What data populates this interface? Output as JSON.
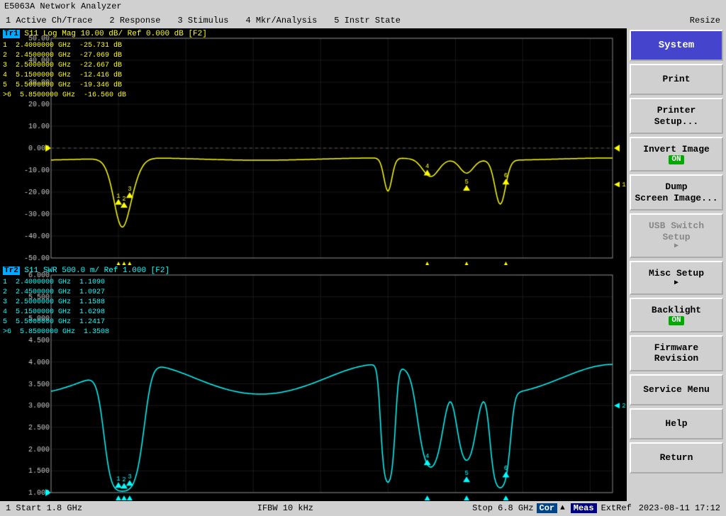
{
  "title": "E5063A Network Analyzer",
  "menu": {
    "items": [
      "1 Active Ch/Trace",
      "2 Response",
      "3 Stimulus",
      "4 Mkr/Analysis",
      "5 Instr State"
    ],
    "resize": "Resize"
  },
  "chart_top": {
    "trace_label": "Tr1",
    "trace_info": "S11  Log Mag  10.00 dB/  Ref  0.000 dB  [F2]",
    "y_max": "50.00",
    "y_ref": "0.000",
    "y_min": "-50.00",
    "markers": [
      {
        "id": "1",
        "freq": "2.4000000",
        "unit": "GHz",
        "val": "-25.731",
        "dbu": "dB"
      },
      {
        "id": "2",
        "freq": "2.4500000",
        "unit": "GHz",
        "val": "-27.069",
        "dbu": "dB"
      },
      {
        "id": "3",
        "freq": "2.5000000",
        "unit": "GHz",
        "val": "-22.667",
        "dbu": "dB"
      },
      {
        "id": "4",
        "freq": "5.1500000",
        "unit": "GHz",
        "val": "-12.416",
        "dbu": "dB"
      },
      {
        "id": "5",
        "freq": "5.5000000",
        "unit": "GHz",
        "val": "-19.346",
        "dbu": "dB"
      },
      {
        "id": ">6",
        "freq": "5.8500000",
        "unit": "GHz",
        "val": "-16.560",
        "dbu": "dB"
      }
    ]
  },
  "chart_bottom": {
    "trace_label": "Tr2",
    "trace_info": "S11  SWR  500.0 m/  Ref  1.000   [F2]",
    "y_max": "6.000",
    "y_ref": "1.000",
    "y_min": "1.000",
    "markers": [
      {
        "id": "1",
        "freq": "2.4000000",
        "unit": "GHz",
        "val": "1.1090"
      },
      {
        "id": "2",
        "freq": "2.4500000",
        "unit": "GHz",
        "val": "1.0927"
      },
      {
        "id": "3",
        "freq": "2.5000000",
        "unit": "GHz",
        "val": "1.1588"
      },
      {
        "id": "4",
        "freq": "5.1500000",
        "unit": "GHz",
        "val": "1.6298"
      },
      {
        "id": "5",
        "freq": "5.5000000",
        "unit": "GHz",
        "val": "1.2417"
      },
      {
        "id": ">6",
        "freq": "5.8500000",
        "unit": "GHz",
        "val": "1.3508"
      }
    ]
  },
  "right_panel": {
    "buttons": [
      {
        "label": "System",
        "type": "system"
      },
      {
        "label": "Print",
        "type": "normal"
      },
      {
        "label": "Printer Setup...",
        "type": "normal"
      },
      {
        "label": "Invert Image\nON",
        "type": "on"
      },
      {
        "label": "Dump\nScreen Image...",
        "type": "normal"
      },
      {
        "label": "USB Switch\nSetup",
        "type": "arrow"
      },
      {
        "label": "Misc Setup",
        "type": "arrow"
      },
      {
        "label": "Backlight\nON",
        "type": "on"
      },
      {
        "label": "Firmware\nRevision",
        "type": "normal"
      },
      {
        "label": "Service Menu",
        "type": "normal"
      },
      {
        "label": "Help",
        "type": "normal"
      },
      {
        "label": "Return",
        "type": "normal"
      }
    ]
  },
  "status_bar": {
    "left": "1  Start  1.8 GHz",
    "center": "IFBW  10 kHz",
    "right": "Stop  6.8 GHz",
    "cor": "Cor",
    "meas": "Meas",
    "extref": "ExtRef",
    "time": "2023-08-11  17:12"
  }
}
